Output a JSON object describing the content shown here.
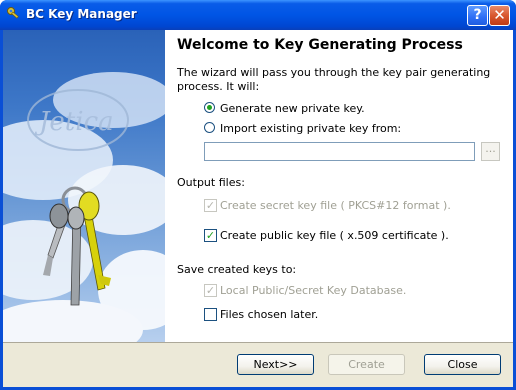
{
  "window": {
    "title": "BC Key Manager"
  },
  "titlebar": {
    "help_glyph": "?",
    "close_glyph": "✕"
  },
  "side_image": {
    "logo_text": "Jetica",
    "description_icon": "keys-on-sky-illustration"
  },
  "heading": "Welcome to Key Generating Process",
  "intro": "The wizard will pass you through the key pair generating process. It will:",
  "key_source": {
    "options": [
      {
        "label": "Generate new private key.",
        "selected": true
      },
      {
        "label": "Import existing private key from:",
        "selected": false
      }
    ],
    "path_value": "",
    "browse_label": "..."
  },
  "output_files": {
    "label": "Output files:",
    "secret_key": {
      "label": "Create secret key file ( PKCS#12  format ).",
      "checked": true,
      "enabled": false
    },
    "public_key": {
      "label": "Create public key file ( x.509 certificate ).",
      "checked": true,
      "enabled": true
    }
  },
  "save_keys": {
    "label": "Save created keys to:",
    "local_db": {
      "label": "Local Public/Secret Key Database.",
      "checked": true,
      "enabled": false
    },
    "files_later": {
      "label": "Files chosen later.",
      "checked": false,
      "enabled": true
    }
  },
  "buttons": {
    "next": "Next>>",
    "create": "Create",
    "close": "Close"
  },
  "colors": {
    "titlebar": "#0055e5",
    "footer": "#ece9d8",
    "check_mark": "#21a121",
    "disabled_text": "#a0a094"
  }
}
